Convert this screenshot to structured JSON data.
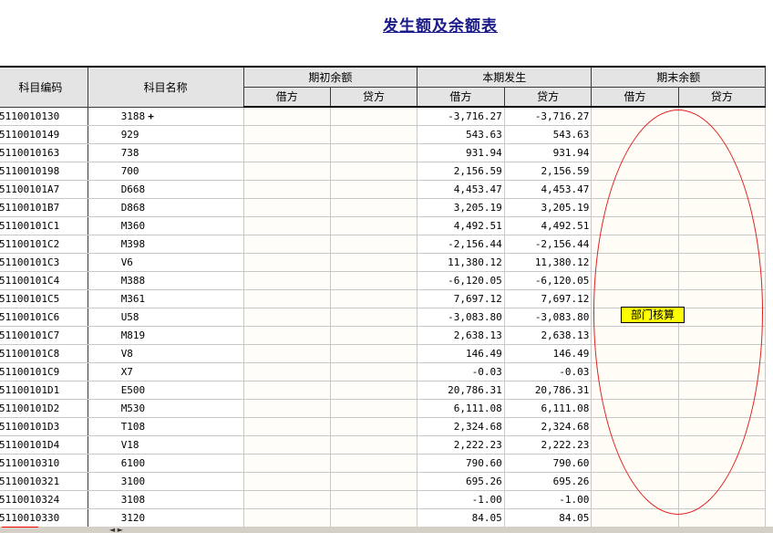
{
  "title": "发生额及余额表",
  "headers": {
    "code": "科目编码",
    "name": "科目名称",
    "opening": "期初余额",
    "current": "本期发生",
    "closing": "期末余额",
    "debit": "借方",
    "credit": "贷方"
  },
  "rows": [
    {
      "code": "5110010130",
      "name": "3188",
      "debit": "-3,716.27",
      "credit": "-3,716.27"
    },
    {
      "code": "5110010149",
      "name": "929",
      "debit": "543.63",
      "credit": "543.63"
    },
    {
      "code": "5110010163",
      "name": "738",
      "debit": "931.94",
      "credit": "931.94"
    },
    {
      "code": "5110010198",
      "name": "700",
      "debit": "2,156.59",
      "credit": "2,156.59"
    },
    {
      "code": "51100101A7",
      "name": "D668",
      "debit": "4,453.47",
      "credit": "4,453.47"
    },
    {
      "code": "51100101B7",
      "name": "D868",
      "debit": "3,205.19",
      "credit": "3,205.19"
    },
    {
      "code": "51100101C1",
      "name": "M360",
      "debit": "4,492.51",
      "credit": "4,492.51"
    },
    {
      "code": "51100101C2",
      "name": "M398",
      "debit": "-2,156.44",
      "credit": "-2,156.44"
    },
    {
      "code": "51100101C3",
      "name": "V6",
      "debit": "11,380.12",
      "credit": "11,380.12"
    },
    {
      "code": "51100101C4",
      "name": "M388",
      "debit": "-6,120.05",
      "credit": "-6,120.05"
    },
    {
      "code": "51100101C5",
      "name": "M361",
      "debit": "7,697.12",
      "credit": "7,697.12"
    },
    {
      "code": "51100101C6",
      "name": "U58",
      "debit": "-3,083.80",
      "credit": "-3,083.80"
    },
    {
      "code": "51100101C7",
      "name": "M819",
      "debit": "2,638.13",
      "credit": "2,638.13"
    },
    {
      "code": "51100101C8",
      "name": "V8",
      "debit": "146.49",
      "credit": "146.49"
    },
    {
      "code": "51100101C9",
      "name": "X7",
      "debit": "-0.03",
      "credit": "-0.03"
    },
    {
      "code": "51100101D1",
      "name": "E500",
      "debit": "20,786.31",
      "credit": "20,786.31"
    },
    {
      "code": "51100101D2",
      "name": "M530",
      "debit": "6,111.08",
      "credit": "6,111.08"
    },
    {
      "code": "51100101D3",
      "name": "T108",
      "debit": "2,324.68",
      "credit": "2,324.68"
    },
    {
      "code": "51100101D4",
      "name": "V18",
      "debit": "2,222.23",
      "credit": "2,222.23"
    },
    {
      "code": "5110010310",
      "name": "6100",
      "debit": "790.60",
      "credit": "790.60"
    },
    {
      "code": "5110010321",
      "name": "3100",
      "debit": "695.26",
      "credit": "695.26"
    },
    {
      "code": "5110010324",
      "name": "3108",
      "debit": "-1.00",
      "credit": "-1.00"
    },
    {
      "code": "5110010330",
      "name": "3120",
      "debit": "84.05",
      "credit": "84.05"
    }
  ],
  "annotation": {
    "label": "部门核算",
    "ellipse_color": "#e02020",
    "label_bg": "#ffff00"
  },
  "cursor_glyph": "+",
  "title_color": "#1a1a8a"
}
